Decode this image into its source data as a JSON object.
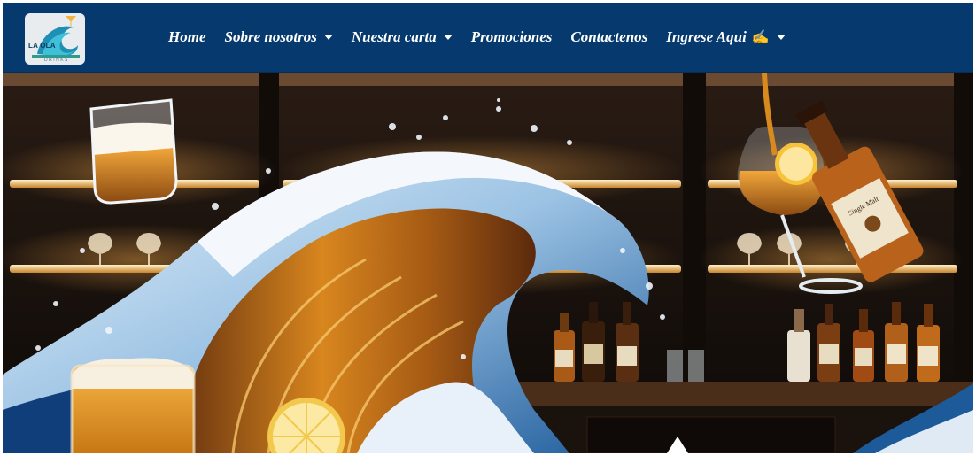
{
  "logo": {
    "title": "LA OLA",
    "subtitle": "DRINKS",
    "icon": "wave-cocktail-logo-icon"
  },
  "nav": {
    "items": [
      {
        "label": "Home",
        "has_dropdown": false
      },
      {
        "label": "Sobre nosotros",
        "has_dropdown": true
      },
      {
        "label": "Nuestra carta",
        "has_dropdown": true
      },
      {
        "label": "Promociones",
        "has_dropdown": false
      },
      {
        "label": "Contactenos",
        "has_dropdown": false
      },
      {
        "label": "Ingrese Aqui",
        "has_dropdown": true,
        "icon": "pointing-hand-icon"
      }
    ]
  },
  "hero": {
    "image": "bar-wave-drinks-banner",
    "bottle_label": "Single Malt"
  },
  "colors": {
    "navbar": "#063a6e",
    "nav_text": "#ffffff",
    "accent_gold": "#f2b43c"
  }
}
